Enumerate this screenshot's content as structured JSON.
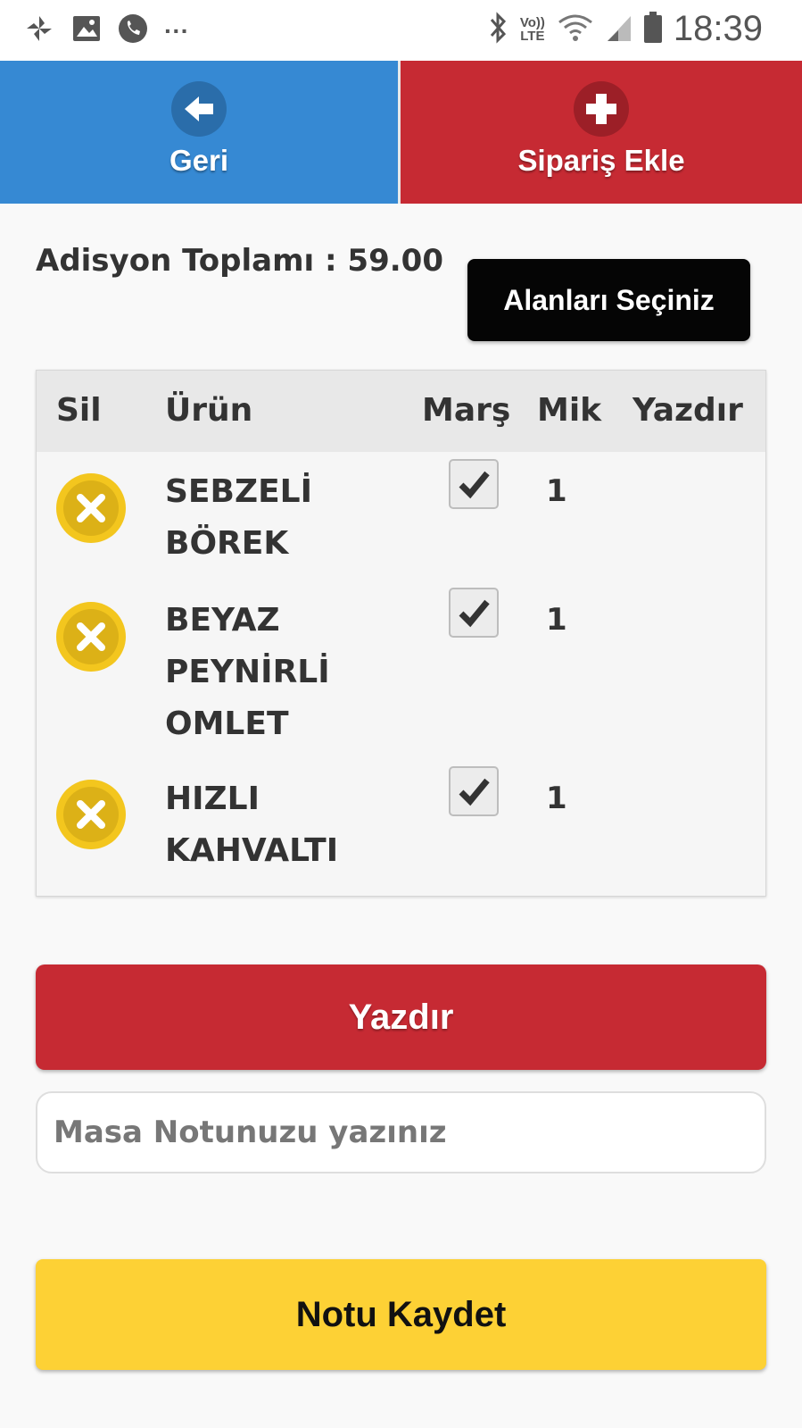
{
  "status_bar": {
    "time": "18:39",
    "network_top": "Vo))",
    "network_bottom": "LTE",
    "more": "···",
    "icons": [
      "pinwheel-icon",
      "image-icon",
      "phone-icon",
      "bluetooth-icon",
      "wifi-icon",
      "signal-icon",
      "battery-icon"
    ]
  },
  "top_bar": {
    "back_label": "Geri",
    "add_order_label": "Sipariş Ekle",
    "back_color": "#3689d3",
    "add_color": "#c62a33"
  },
  "summary": {
    "total_text": "Adisyon Toplamı : 59.00",
    "select_fields_label": "Alanları Seçiniz"
  },
  "table": {
    "headers": {
      "sil": "Sil",
      "urun": "Ürün",
      "mars": "Marş",
      "mik": "Mik",
      "yazdir": "Yazdır"
    },
    "rows": [
      {
        "product_lines": [
          "SEBZELİ",
          "BÖREK"
        ],
        "mars": true,
        "qty": "1",
        "print": ""
      },
      {
        "product_lines": [
          "BEYAZ",
          "PEYNİRLİ",
          "OMLET"
        ],
        "mars": true,
        "qty": "1",
        "print": ""
      },
      {
        "product_lines": [
          "HIZLI",
          "KAHVALTI"
        ],
        "mars": true,
        "qty": "1",
        "print": ""
      }
    ]
  },
  "actions": {
    "print_label": "Yazdır",
    "note_value": "",
    "note_placeholder": "Masa Notunuzu yazınız",
    "save_note_label": "Notu Kaydet",
    "print_color": "#c62a33",
    "save_color": "#fdd135"
  }
}
